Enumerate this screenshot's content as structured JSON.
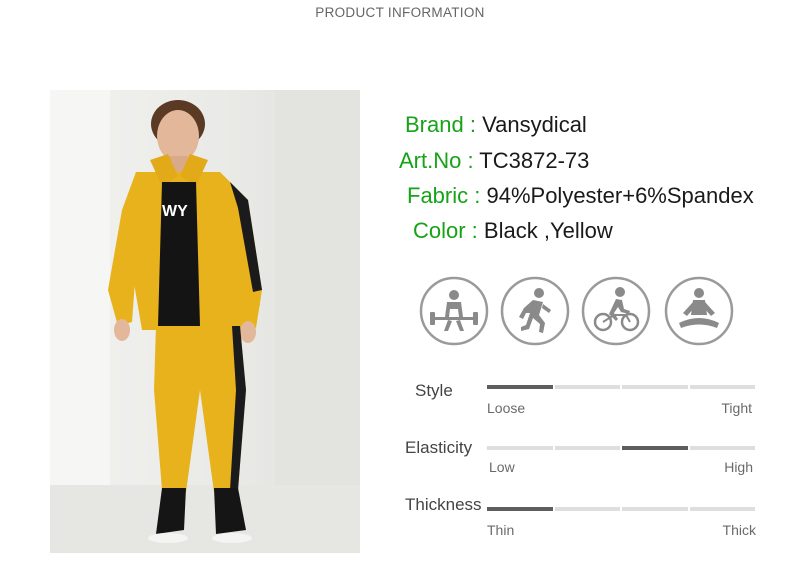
{
  "header": {
    "title": "PRODUCT INFORMATION"
  },
  "info": {
    "brand": {
      "label": "Brand :",
      "value": "Vansydical"
    },
    "artno": {
      "label": "Art.No :",
      "value": "TC3872-73"
    },
    "fabric": {
      "label": "Fabric :",
      "value": "94%Polyester+6%Spandex"
    },
    "color": {
      "label": "Color :",
      "value": "Black ,Yellow"
    }
  },
  "activity_icons": [
    "weightlifting-icon",
    "running-icon",
    "cycling-icon",
    "meditation-icon"
  ],
  "ratings": [
    {
      "label": "Style",
      "low": "Loose",
      "high": "Tight",
      "active_segment": 1,
      "segments": 4
    },
    {
      "label": "Elasticity",
      "low": "Low",
      "high": "High",
      "active_segment": 3,
      "segments": 4
    },
    {
      "label": "Thickness",
      "low": "Thin",
      "high": "Thick",
      "active_segment": 1,
      "segments": 4
    }
  ],
  "colors": {
    "label_green": "#17a317",
    "value_dark": "#1a1a1a",
    "bar_active": "#5e5e5e",
    "bar_inactive": "#dedede",
    "jacket_yellow": "#e8b21c",
    "stripe_black": "#1b1b1b"
  }
}
